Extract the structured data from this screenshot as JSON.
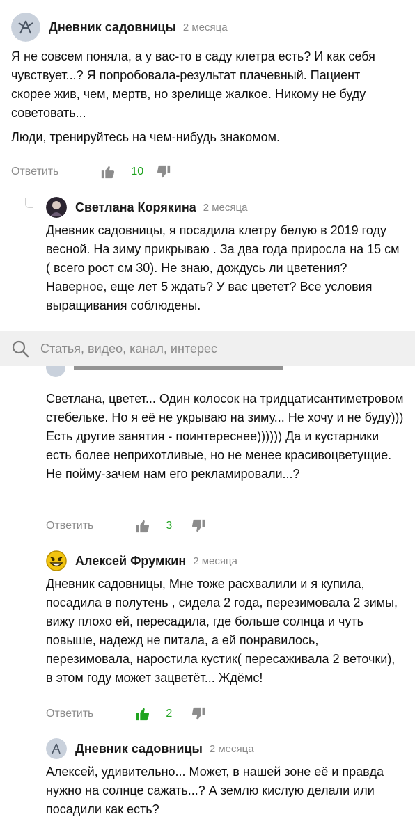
{
  "comments": [
    {
      "author": "Дневник садовницы",
      "time": "2 месяца",
      "paragraphs": [
        "Я не совсем поняла, а у вас-то в саду клетра есть? И как себя чувствует...? Я попробовала-результат плачевный. Пациент скорее жив, чем, мертв, но зрелище жалкое. Никому не буду советовать...",
        "Люди, тренируйтесь на чем-нибудь знакомом."
      ],
      "reply": "Ответить",
      "likes": "10"
    },
    {
      "author": "Светлана Корякина",
      "time": "2 месяца",
      "paragraphs": [
        "Дневник садовницы, я посадила клетру белую в 2019 году весной. На зиму прикрываю . За два года приросла на 15 см ( всего рост см 30). Не знаю, дождусь ли цветения? Наверное, еще лет 5 ждать? У вас цветет? Все условия выращивания соблюдены."
      ]
    },
    {
      "paragraphs": [
        "Светлана, цветет... Один колосок на тридцатисантиметровом стебельке. Но я её не укрываю на зиму... Не хочу и не буду))) Есть другие занятия - поинтереснее)))))) Да и кустарники есть более неприхотливые, но не менее красивоцветущие. Не пойму-зачем нам его рекламировали...?"
      ],
      "reply": "Ответить",
      "likes": "3"
    },
    {
      "author": "Алексей Фрумкин",
      "time": "2 месяца",
      "paragraphs": [
        "Дневник садовницы, Мне тоже расхвалили и я купила, посадила в полутень , сидела 2 года, перезимовала 2 зимы, вижу плохо ей, пересадила, где больше солнца и чуть повыше, надежд не питала, а ей понравилось, перезимовала, наростила кустик( пересаживала 2 веточки), в этом году может зацветёт... Ждёмс!"
      ],
      "reply": "Ответить",
      "likes": "2"
    },
    {
      "author": "Дневник садовницы",
      "time": "2 месяца",
      "paragraphs": [
        "Алексей, удивительно... Может, в нашей зоне её и правда нужно на солнце сажать...? А землю кислую делали или посадили как есть?"
      ]
    }
  ],
  "search": {
    "placeholder": "Статья, видео, канал, интерес"
  },
  "colors": {
    "likes_count": "#1fa31f",
    "meta_text": "#8a8a8a",
    "search_bg": "#f0f0f0"
  },
  "icons": {
    "like": "thumbs-up-icon",
    "dislike": "thumbs-down-icon",
    "search": "search-icon"
  }
}
